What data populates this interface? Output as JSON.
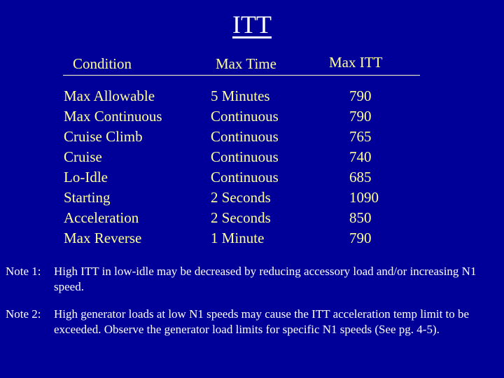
{
  "title": "ITT",
  "table": {
    "headers": {
      "condition": "Condition",
      "max_time": "Max Time",
      "max_itt": "Max ITT"
    },
    "rows": [
      {
        "condition": "Max Allowable",
        "max_time": "5 Minutes",
        "max_itt": "790"
      },
      {
        "condition": "Max Continuous",
        "max_time": "Continuous",
        "max_itt": "790"
      },
      {
        "condition": "Cruise Climb",
        "max_time": "Continuous",
        "max_itt": "765"
      },
      {
        "condition": "Cruise",
        "max_time": "Continuous",
        "max_itt": "740"
      },
      {
        "condition": "Lo-Idle",
        "max_time": "Continuous",
        "max_itt": "685"
      },
      {
        "condition": "Starting",
        "max_time": "2 Seconds",
        "max_itt": "1090"
      },
      {
        "condition": "Acceleration",
        "max_time": "2 Seconds",
        "max_itt": "850"
      },
      {
        "condition": "Max Reverse",
        "max_time": "1 Minute",
        "max_itt": "790"
      }
    ]
  },
  "notes": [
    {
      "label": "Note 1:",
      "text": "High ITT in low-idle may be decreased by reducing accessory  load and/or increasing N1 speed."
    },
    {
      "label": "Note 2:",
      "text": "High generator loads at low N1 speeds may cause the ITT acceleration temp limit to be exceeded. Observe the generator load limits for specific N1 speeds (See pg. 4-5)."
    }
  ]
}
